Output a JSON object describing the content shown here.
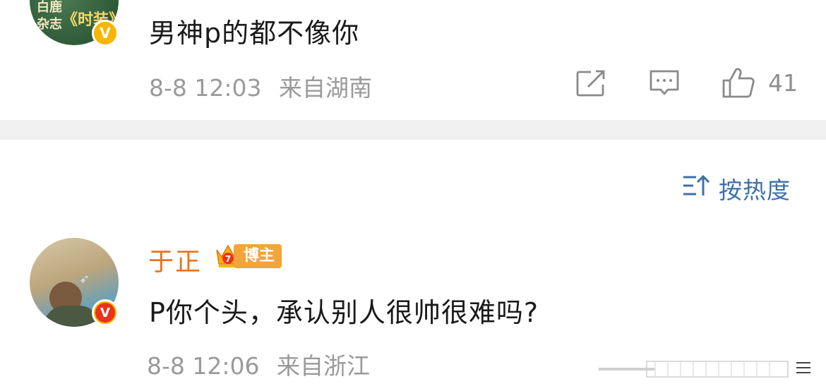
{
  "comment1": {
    "avatar_text": [
      "白鹿",
      "杂志",
      "《时装》"
    ],
    "text": "男神p的都不像你",
    "time": "8-8 12:03",
    "source": "来自湖南",
    "like_count": "41",
    "icons": {
      "share": "share-icon",
      "reply": "comment-icon",
      "like": "thumbs-up-icon",
      "verified": "verified-badge-icon"
    }
  },
  "sort": {
    "label": "按热度",
    "icon": "sort-icon"
  },
  "comment2": {
    "username": "于正",
    "badge": "博主",
    "badge_level": "7",
    "text": "P你个头，承认别人很帅很难吗?",
    "time": "8-8 12:06",
    "source": "来自浙江",
    "colors": {
      "username": "#e8731a",
      "badge": "#f3a43a"
    }
  },
  "colors": {
    "meta": "#9a9a9a",
    "sort_link": "#3f6fa8",
    "separator": "#f0f0f0",
    "verified_yellow": "#f7b500",
    "verified_red": "#e8341c"
  }
}
